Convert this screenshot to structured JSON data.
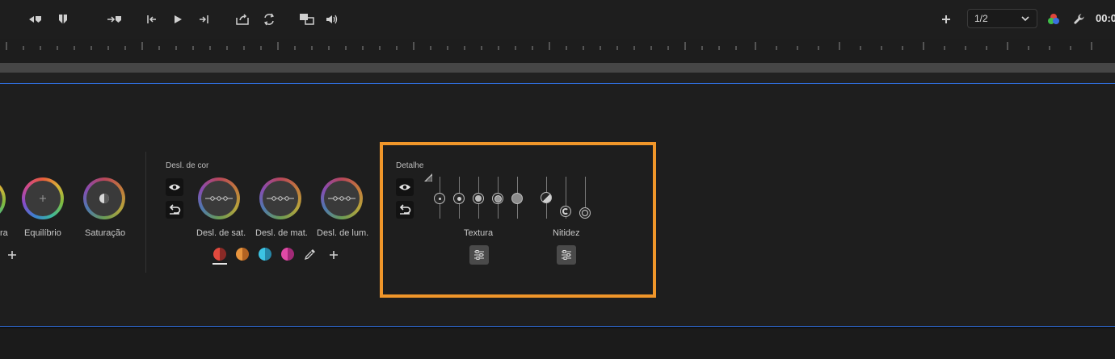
{
  "toolbar": {
    "zoom_value": "1/2",
    "timecode": "00:0"
  },
  "panel": {
    "wheels_left": [
      {
        "label": "ra"
      },
      {
        "label": "Equilíbrio"
      },
      {
        "label": "Saturação"
      }
    ],
    "color_shift": {
      "title": "Desl. de cor",
      "wheels": [
        {
          "label": "Desl. de sat."
        },
        {
          "label": "Desl. de mat."
        },
        {
          "label": "Desl. de lum."
        }
      ],
      "swatches": [
        {
          "name": "red",
          "color": "#d8413a"
        },
        {
          "name": "orange",
          "color": "#e08a3a"
        },
        {
          "name": "cyan",
          "color": "#3ab8d8"
        },
        {
          "name": "magenta",
          "color": "#d43c9a"
        }
      ]
    },
    "detail": {
      "title": "Detalhe",
      "texture_label": "Textura",
      "sharpness_label": "Nitidez"
    }
  },
  "colors": {
    "highlight_border": "#f0962a",
    "panel_border": "#2f6bd6"
  }
}
